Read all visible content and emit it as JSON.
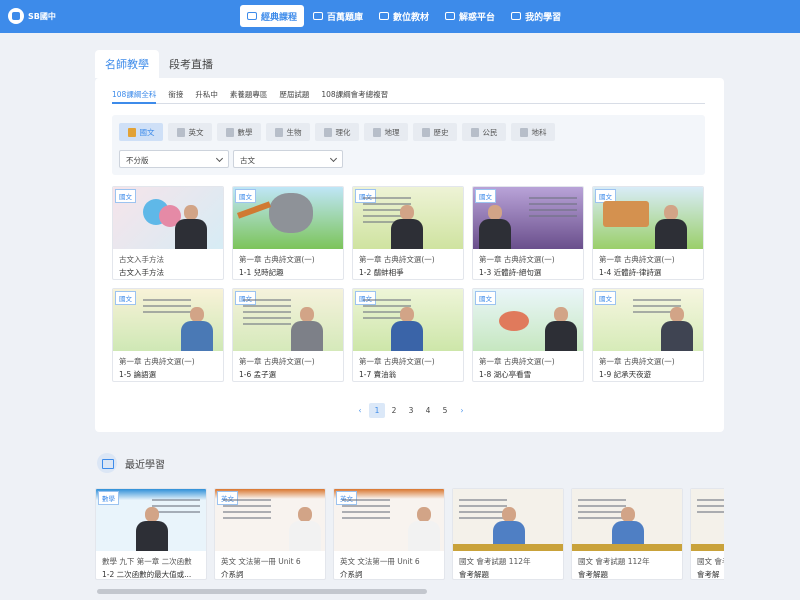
{
  "brand": {
    "name": "SB國中"
  },
  "nav": [
    {
      "label": "經典課程",
      "icon": "play-icon",
      "active": true
    },
    {
      "label": "百萬題庫",
      "icon": "document-icon",
      "active": false
    },
    {
      "label": "數位教材",
      "icon": "cloud-icon",
      "active": false
    },
    {
      "label": "解惑平台",
      "icon": "search-icon",
      "active": false
    },
    {
      "label": "我的學習",
      "icon": "pencil-icon",
      "active": false
    }
  ],
  "main_tabs": [
    {
      "label": "名師教學",
      "active": true
    },
    {
      "label": "段考直播",
      "active": false
    }
  ],
  "sub_tabs": [
    {
      "label": "108課綱全科",
      "active": true
    },
    {
      "label": "銜接",
      "active": false
    },
    {
      "label": "升私中",
      "active": false
    },
    {
      "label": "素養題專區",
      "active": false
    },
    {
      "label": "歷屆試題",
      "active": false
    },
    {
      "label": "108課綱會考總複習",
      "active": false
    }
  ],
  "subjects": [
    {
      "label": "國文",
      "active": true
    },
    {
      "label": "英文",
      "active": false
    },
    {
      "label": "數學",
      "active": false
    },
    {
      "label": "生物",
      "active": false
    },
    {
      "label": "理化",
      "active": false
    },
    {
      "label": "地理",
      "active": false
    },
    {
      "label": "歷史",
      "active": false
    },
    {
      "label": "公民",
      "active": false
    },
    {
      "label": "地科",
      "active": false
    }
  ],
  "filters": {
    "version": "不分版",
    "category": "古文"
  },
  "videos": [
    {
      "tag": "國文",
      "chapter": "古文入手方法",
      "title": "古文入手方法"
    },
    {
      "tag": "國文",
      "chapter": "第一章 古典詩文選(一)",
      "title": "1-1 兒時記趣"
    },
    {
      "tag": "國文",
      "chapter": "第一章 古典詩文選(一)",
      "title": "1-2 鷸蚌相爭"
    },
    {
      "tag": "國文",
      "chapter": "第一章 古典詩文選(一)",
      "title": "1-3 近體詩-絕句選"
    },
    {
      "tag": "國文",
      "chapter": "第一章 古典詩文選(一)",
      "title": "1-4 近體詩-律詩選"
    },
    {
      "tag": "國文",
      "chapter": "第一章 古典詩文選(一)",
      "title": "1-5 論語選"
    },
    {
      "tag": "國文",
      "chapter": "第一章 古典詩文選(一)",
      "title": "1-6 孟子選"
    },
    {
      "tag": "國文",
      "chapter": "第一章 古典詩文選(一)",
      "title": "1-7 賣油翁"
    },
    {
      "tag": "國文",
      "chapter": "第一章 古典詩文選(一)",
      "title": "1-8 湖心亭看雪"
    },
    {
      "tag": "國文",
      "chapter": "第一章 古典詩文選(一)",
      "title": "1-9 記承天夜遊"
    }
  ],
  "pagination": {
    "prev": "‹",
    "pages": [
      "1",
      "2",
      "3",
      "4",
      "5"
    ],
    "current": "1",
    "next": "›"
  },
  "recent": {
    "heading": "最近學習",
    "items": [
      {
        "tag": "數學",
        "chapter": "數學 九下 第一章 二次函數",
        "title": "1-2 二次函數的最大值或..."
      },
      {
        "tag": "英文",
        "chapter": "英文 文法第一冊 Unit 6",
        "title": "介系詞"
      },
      {
        "tag": "英文",
        "chapter": "英文 文法第一冊 Unit 6",
        "title": "介系詞"
      },
      {
        "tag": "",
        "chapter": "國文 會考試題 112年",
        "title": "會考解題"
      },
      {
        "tag": "",
        "chapter": "國文 會考試題 112年",
        "title": "會考解題"
      },
      {
        "tag": "",
        "chapter": "國文 會考",
        "title": "會考解"
      }
    ]
  },
  "colors": {
    "primary": "#3d8bea",
    "page_bg": "#eef1f6"
  }
}
